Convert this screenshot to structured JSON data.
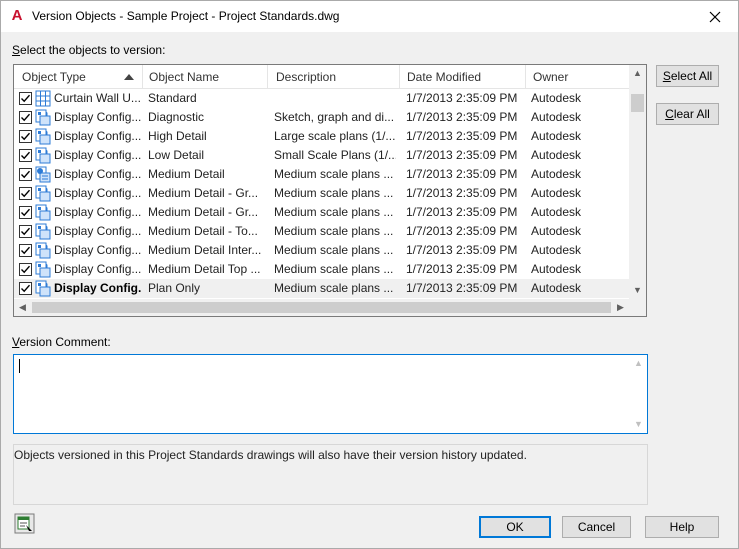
{
  "window": {
    "app_icon_letter": "A",
    "title": "Version Objects - Sample Project - Project Standards.dwg",
    "close_glyph": "✕"
  },
  "select_label": {
    "accel": "S",
    "rest": "elect the objects to version:"
  },
  "table": {
    "columns": [
      "Object Type",
      "Object Name",
      "Description",
      "Date Modified",
      "Owner"
    ],
    "sort_column": "Object Type",
    "sort_direction": "ascending",
    "rows": [
      {
        "checked": true,
        "icon": "curtain-wall-icon",
        "type": "Curtain Wall U...",
        "name": "Standard",
        "description": "",
        "date": "1/7/2013 2:35:09 PM",
        "owner": "Autodesk"
      },
      {
        "checked": true,
        "icon": "display-config-icon",
        "type": "Display Config...",
        "name": "Diagnostic",
        "description": "Sketch, graph and di...",
        "date": "1/7/2013 2:35:09 PM",
        "owner": "Autodesk"
      },
      {
        "checked": true,
        "icon": "display-config-icon",
        "type": "Display Config...",
        "name": "High Detail",
        "description": "Large scale plans (1/...",
        "date": "1/7/2013 2:35:09 PM",
        "owner": "Autodesk"
      },
      {
        "checked": true,
        "icon": "display-config-icon",
        "type": "Display Config...",
        "name": "Low Detail",
        "description": "Small Scale Plans (1/...",
        "date": "1/7/2013 2:35:09 PM",
        "owner": "Autodesk"
      },
      {
        "checked": true,
        "icon": "display-config-set-icon",
        "type": "Display Config...",
        "name": "Medium Detail",
        "description": "Medium scale plans ...",
        "date": "1/7/2013 2:35:09 PM",
        "owner": "Autodesk"
      },
      {
        "checked": true,
        "icon": "display-config-icon",
        "type": "Display Config...",
        "name": "Medium Detail - Gr...",
        "description": "Medium scale plans ...",
        "date": "1/7/2013 2:35:09 PM",
        "owner": "Autodesk"
      },
      {
        "checked": true,
        "icon": "display-config-icon",
        "type": "Display Config...",
        "name": "Medium Detail - Gr...",
        "description": "Medium scale plans ...",
        "date": "1/7/2013 2:35:09 PM",
        "owner": "Autodesk"
      },
      {
        "checked": true,
        "icon": "display-config-icon",
        "type": "Display Config...",
        "name": "Medium Detail - To...",
        "description": "Medium scale plans ...",
        "date": "1/7/2013 2:35:09 PM",
        "owner": "Autodesk"
      },
      {
        "checked": true,
        "icon": "display-config-icon",
        "type": "Display Config...",
        "name": "Medium Detail Inter...",
        "description": "Medium scale plans ...",
        "date": "1/7/2013 2:35:09 PM",
        "owner": "Autodesk"
      },
      {
        "checked": true,
        "icon": "display-config-icon",
        "type": "Display Config...",
        "name": "Medium Detail Top ...",
        "description": "Medium scale plans ...",
        "date": "1/7/2013 2:35:09 PM",
        "owner": "Autodesk"
      },
      {
        "checked": true,
        "icon": "display-config-icon",
        "type": "Display Config...",
        "name": "Plan Only",
        "description": "Medium scale plans ...",
        "date": "1/7/2013 2:35:09 PM",
        "owner": "Autodesk",
        "selected": true
      }
    ]
  },
  "buttons": {
    "select_all_accel": "S",
    "select_all_rest": "elect All",
    "clear_all_accel": "C",
    "clear_all_rest": "lear All",
    "ok": "OK",
    "cancel": "Cancel",
    "help": "Help"
  },
  "version_comment": {
    "label_accel": "V",
    "label_rest": "ersion Comment:",
    "value": ""
  },
  "info_text": "Objects versioned in this Project Standards drawings will also have their version history updated.",
  "icons": {
    "app": "autocad-icon",
    "bottom_left": "display-manager-icon"
  },
  "colors": {
    "accent": "#0078d7",
    "app_red": "#c8102e",
    "icon_blue": "#2d7bd6"
  }
}
